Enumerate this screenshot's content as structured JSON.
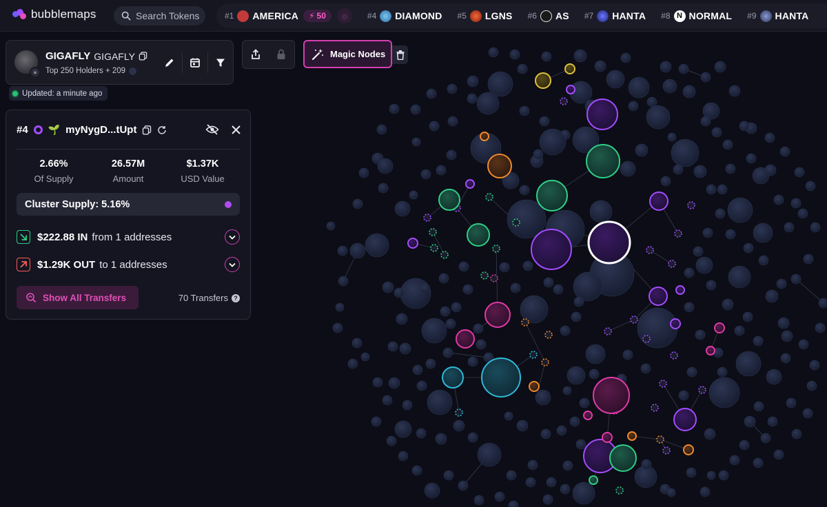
{
  "app": {
    "brand": "bubblemaps",
    "search_placeholder": "Search Tokens"
  },
  "ticker": [
    {
      "rank": "#1",
      "name": "AMERICA",
      "icon_color": "#c23a3a",
      "boost": "50"
    },
    {
      "rank": "#4",
      "name": "DIAMOND",
      "icon_color": "#4aa8e0"
    },
    {
      "rank": "#5",
      "name": "LGNS",
      "icon_color": "#e0562a"
    },
    {
      "rank": "#6",
      "name": "AS",
      "icon_color": "#202020"
    },
    {
      "rank": "#7",
      "name": "HANTA",
      "icon_color": "#3d4bd6"
    },
    {
      "rank": "#8",
      "name": "NORMAL",
      "icon_color": "#ffffff",
      "badge": "N"
    },
    {
      "rank": "#9",
      "name": "HANTA",
      "icon_color": "#5a6aa8"
    }
  ],
  "token": {
    "name": "GIGAFLY",
    "symbol": "GIGAFLY",
    "subtitle": "Top 250 Holders + 209",
    "updated": "Updated: a minute ago"
  },
  "toolbar": {
    "magic_nodes": "Magic Nodes"
  },
  "holder": {
    "rank": "#4",
    "address": "myNygD...tUpt",
    "stats": [
      {
        "value": "2.66%",
        "label": "Of Supply"
      },
      {
        "value": "26.57M",
        "label": "Amount"
      },
      {
        "value": "$1.37K",
        "label": "USD Value"
      }
    ],
    "cluster_supply": "Cluster Supply: 5.16%",
    "inflow": {
      "amount": "$222.88 IN",
      "text": "from 1 addresses"
    },
    "outflow": {
      "amount": "$1.29K OUT",
      "text": "to 1 addresses"
    },
    "show_all": "Show All Transfers",
    "transfers": "70 Transfers"
  },
  "colors": {
    "accent": "#d53fb3",
    "purple": "#a44cff",
    "green": "#2fcf86",
    "orange": "#f08a2c",
    "cyan": "#2db9d6",
    "magenta": "#e03aa8",
    "yellow": "#e2c43a"
  }
}
